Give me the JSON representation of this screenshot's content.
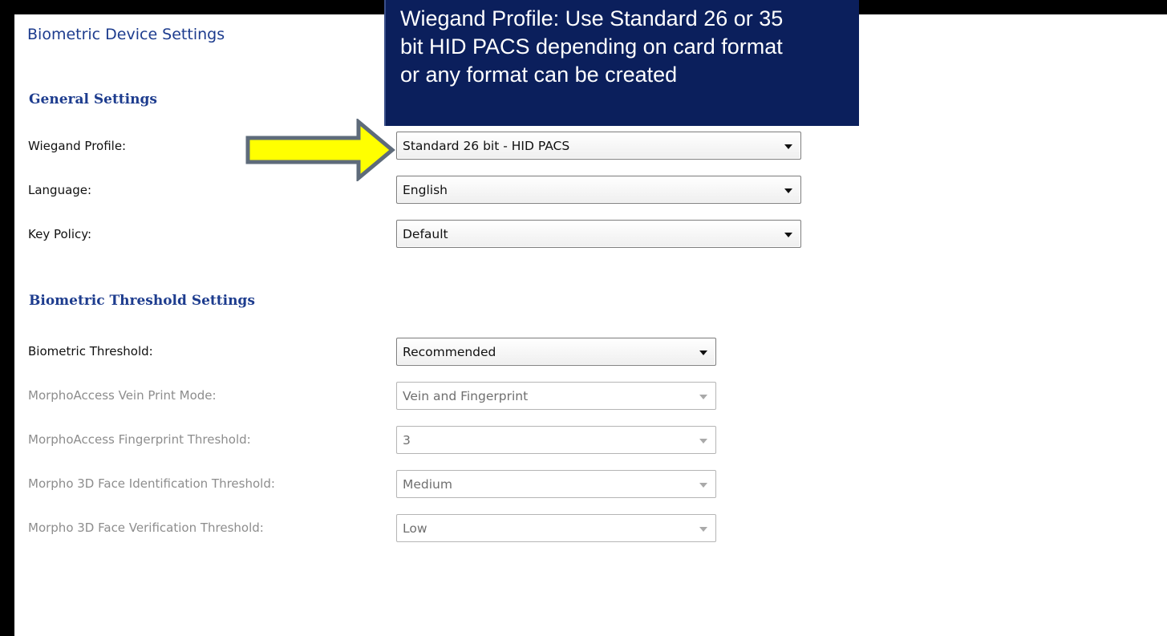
{
  "callout": {
    "lines": [
      "Wiegand Profile: Use Standard 26 or 35",
      "bit HID PACS depending on card format",
      "or any format can be created"
    ]
  },
  "page": {
    "title": "Biometric Device Settings"
  },
  "general": {
    "heading": "General Settings",
    "wiegand_profile": {
      "label": "Wiegand Profile:",
      "value": "Standard 26 bit - HID PACS"
    },
    "language": {
      "label": "Language:",
      "value": "English"
    },
    "key_policy": {
      "label": "Key Policy:",
      "value": "Default"
    }
  },
  "threshold": {
    "heading": "Biometric Threshold Settings",
    "biometric_threshold": {
      "label": "Biometric Threshold:",
      "value": "Recommended"
    },
    "vein_print_mode": {
      "label": "MorphoAccess Vein Print Mode:",
      "value": "Vein and Fingerprint"
    },
    "fingerprint_threshold": {
      "label": "MorphoAccess Fingerprint Threshold:",
      "value": "3"
    },
    "face_identification": {
      "label": "Morpho 3D Face Identification Threshold:",
      "value": "Medium"
    },
    "face_verification": {
      "label": "Morpho 3D Face Verification Threshold:",
      "value": "Low"
    }
  },
  "colors": {
    "heading": "#1d3c8e",
    "callout_bg": "#0b1f5c",
    "arrow_fill": "#ffff00",
    "arrow_stroke": "#5e6b7a",
    "disabled_text": "#8d8d8d"
  },
  "icons": {
    "pointer": "arrow-right-icon",
    "dropdown": "chevron-down-icon"
  }
}
